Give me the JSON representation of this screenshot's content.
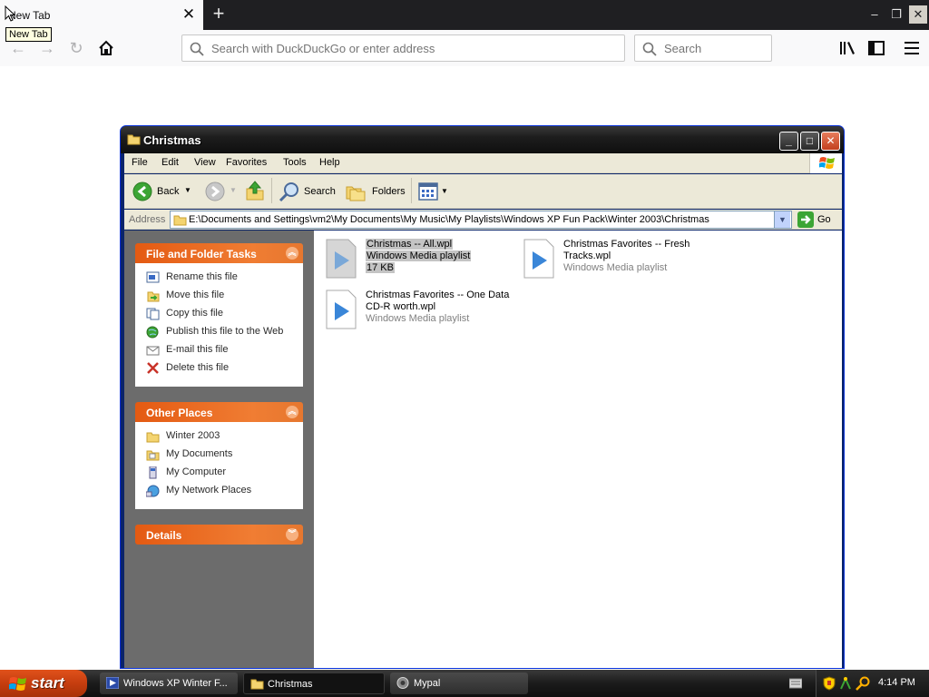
{
  "browser": {
    "tab_title": "New Tab",
    "tooltip": "New Tab",
    "url_placeholder": "Search with DuckDuckGo or enter address",
    "search_placeholder": "Search"
  },
  "window": {
    "title": "Christmas",
    "menu": [
      "File",
      "Edit",
      "View",
      "Favorites",
      "Tools",
      "Help"
    ],
    "toolbar": {
      "back": "Back",
      "search": "Search",
      "folders": "Folders"
    },
    "address_label": "Address",
    "address": "E:\\Documents and Settings\\vm2\\My Documents\\My Music\\My Playlists\\Windows XP Fun Pack\\Winter 2003\\Christmas",
    "go_label": "Go",
    "file_tasks": {
      "title": "File and Folder Tasks",
      "items": [
        "Rename this file",
        "Move this file",
        "Copy this file",
        "Publish this file to the Web",
        "E-mail this file",
        "Delete this file"
      ]
    },
    "other_places": {
      "title": "Other Places",
      "items": [
        "Winter 2003",
        "My Documents",
        "My Computer",
        "My Network Places"
      ]
    },
    "details": {
      "title": "Details"
    },
    "files": [
      {
        "name": "Christmas -- All.wpl",
        "type": "Windows Media playlist",
        "size": "17 KB"
      },
      {
        "name_line1": "Christmas Favorites -- Fresh",
        "name_line2": "Tracks.wpl",
        "type": "Windows Media playlist"
      },
      {
        "name_line1": "Christmas Favorites -- One Data",
        "name_line2": "CD-R worth.wpl",
        "type": "Windows Media playlist"
      }
    ]
  },
  "taskbar": {
    "start": "start",
    "tasks": [
      "Windows XP Winter F...",
      "Christmas",
      "Mypal"
    ],
    "clock": "4:14 PM"
  },
  "colors": {
    "panel_header": "#e45a12",
    "sidebar": "#6c6c6c",
    "selection": "#c4c4c4"
  }
}
